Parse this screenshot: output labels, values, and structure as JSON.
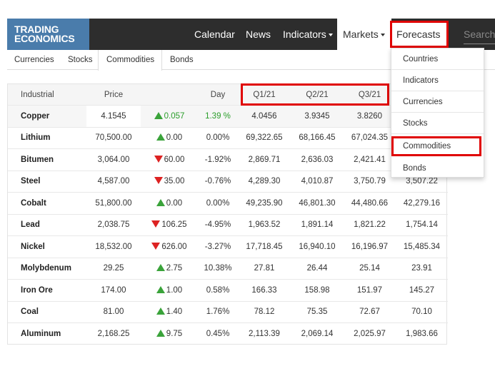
{
  "logo": {
    "line1": "TRADING",
    "line2": "ECONOMICS"
  },
  "nav": {
    "calendar": "Calendar",
    "news": "News",
    "indicators": "Indicators",
    "markets": "Markets",
    "forecasts": "Forecasts",
    "search_placeholder": "Search"
  },
  "subnav": [
    "Currencies",
    "Stocks",
    "Commodities",
    "Bonds"
  ],
  "table": {
    "headers": [
      "Industrial",
      "Price",
      "",
      "Day",
      "Q1/21",
      "Q2/21",
      "Q3/21",
      ""
    ],
    "rows": [
      {
        "name": "Copper",
        "price": "4.1545",
        "dir": "up",
        "change": "0.057",
        "day": "1.39 %",
        "q1": "4.0456",
        "q2": "3.9345",
        "q3": "3.8260",
        "q4": ""
      },
      {
        "name": "Lithium",
        "price": "70,500.00",
        "dir": "up",
        "change": "0.00",
        "day": "0.00%",
        "q1": "69,322.65",
        "q2": "68,166.45",
        "q3": "67,024.35",
        "q4": ""
      },
      {
        "name": "Bitumen",
        "price": "3,064.00",
        "dir": "down",
        "change": "60.00",
        "day": "-1.92%",
        "q1": "2,869.71",
        "q2": "2,636.03",
        "q3": "2,421.41",
        "q4": ""
      },
      {
        "name": "Steel",
        "price": "4,587.00",
        "dir": "down",
        "change": "35.00",
        "day": "-0.76%",
        "q1": "4,289.30",
        "q2": "4,010.87",
        "q3": "3,750.79",
        "q4": "3,507.22"
      },
      {
        "name": "Cobalt",
        "price": "51,800.00",
        "dir": "up",
        "change": "0.00",
        "day": "0.00%",
        "q1": "49,235.90",
        "q2": "46,801.30",
        "q3": "44,480.66",
        "q4": "42,279.16"
      },
      {
        "name": "Lead",
        "price": "2,038.75",
        "dir": "down",
        "change": "106.25",
        "day": "-4.95%",
        "q1": "1,963.52",
        "q2": "1,891.14",
        "q3": "1,821.22",
        "q4": "1,754.14"
      },
      {
        "name": "Nickel",
        "price": "18,532.00",
        "dir": "down",
        "change": "626.00",
        "day": "-3.27%",
        "q1": "17,718.45",
        "q2": "16,940.10",
        "q3": "16,196.97",
        "q4": "15,485.34"
      },
      {
        "name": "Molybdenum",
        "price": "29.25",
        "dir": "up",
        "change": "2.75",
        "day": "10.38%",
        "q1": "27.81",
        "q2": "26.44",
        "q3": "25.14",
        "q4": "23.91"
      },
      {
        "name": "Iron Ore",
        "price": "174.00",
        "dir": "up",
        "change": "1.00",
        "day": "0.58%",
        "q1": "166.33",
        "q2": "158.98",
        "q3": "151.97",
        "q4": "145.27"
      },
      {
        "name": "Coal",
        "price": "81.00",
        "dir": "up",
        "change": "1.40",
        "day": "1.76%",
        "q1": "78.12",
        "q2": "75.35",
        "q3": "72.67",
        "q4": "70.10"
      },
      {
        "name": "Aluminum",
        "price": "2,168.25",
        "dir": "up",
        "change": "9.75",
        "day": "0.45%",
        "q1": "2,113.39",
        "q2": "2,069.14",
        "q3": "2,025.97",
        "q4": "1,983.66"
      }
    ]
  },
  "dropdown": {
    "items": [
      "Countries",
      "Indicators",
      "Currencies",
      "Stocks",
      "Commodities",
      "Bonds"
    ],
    "selected": "Commodities"
  },
  "colors": {
    "highlight": "#e00000",
    "logo_bg": "#4a7cab",
    "topbar_bg": "#2d2d2d",
    "up": "#3aa33a",
    "down": "#dd2222"
  }
}
